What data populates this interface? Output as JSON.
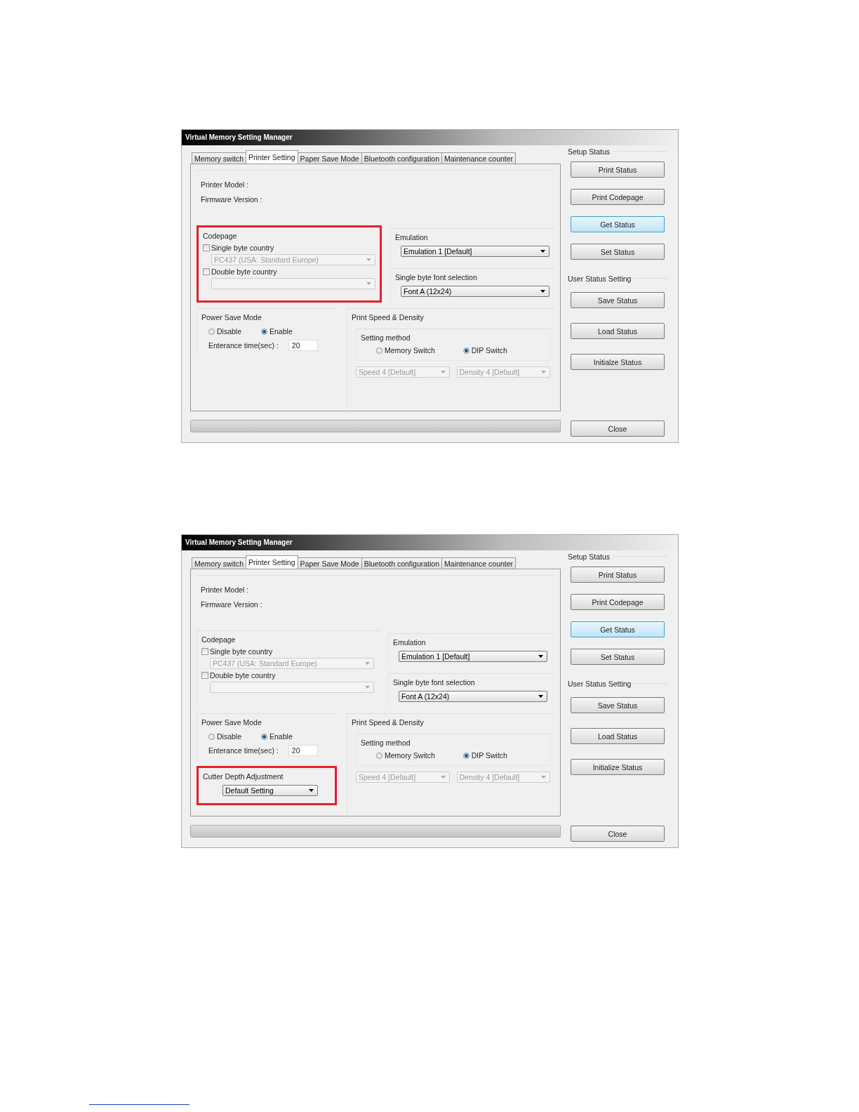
{
  "screenshots": [
    {
      "title": "Virtual Memory Setting Manager",
      "tabs": [
        {
          "label": "Memory switch",
          "selected": false
        },
        {
          "label": "Printer Setting",
          "selected": true
        },
        {
          "label": "Paper Save Mode",
          "selected": false
        },
        {
          "label": "Bluetooth configuration",
          "selected": false
        },
        {
          "label": "Maintenance counter",
          "selected": false
        }
      ],
      "info": [
        "Printer Model :",
        "Firmware Version :"
      ],
      "codepage": {
        "title": "Codepage",
        "highlighted": true,
        "options": [
          {
            "label": "Single byte country",
            "checked": false,
            "combo": {
              "value": "PC437 (USA: Standard Europe)",
              "disabled": true
            }
          },
          {
            "label": "Double byte country",
            "checked": false,
            "combo": {
              "disabled": true
            }
          }
        ]
      },
      "emulation": {
        "title": "Emulation",
        "combo": {
          "value": "Emulation 1 [Default]",
          "disabled": false
        }
      },
      "font_selection": {
        "title": "Single byte font selection",
        "combo": {
          "value": "Font A (12x24)",
          "disabled": false
        }
      },
      "power_save": {
        "title": "Power Save Mode",
        "options": [
          {
            "label": "Disable",
            "selected": false
          },
          {
            "label": "Enable",
            "selected": true
          }
        ],
        "time_label": "Enterance time(sec) :",
        "time_value": "20"
      },
      "speed_density": {
        "title": "Print Speed & Density",
        "method_title": "Setting method",
        "methods": [
          {
            "label": "Memory Switch",
            "selected": false
          },
          {
            "label": "DIP Switch",
            "selected": true
          }
        ],
        "combos": [
          {
            "value": "Speed 4 [Default]",
            "disabled": true
          },
          {
            "value": "Density 4 [Default]",
            "disabled": true
          }
        ]
      },
      "setup_status": {
        "title": "Setup Status",
        "buttons": [
          {
            "label": "Print Status",
            "focused": false
          },
          {
            "label": "Print Codepage",
            "focused": false
          },
          {
            "label": "Get Status",
            "focused": true
          },
          {
            "label": "Set Status",
            "focused": false
          }
        ]
      },
      "user_status": {
        "title": "User Status Setting",
        "buttons": [
          "Save Status",
          "Load Status",
          "Initialze Status"
        ]
      },
      "progress": {
        "level": 1
      },
      "close": "Close"
    },
    {
      "title": "Virtual Memory Setting Manager",
      "tabs": [
        {
          "label": "Memory switch",
          "selected": false
        },
        {
          "label": "Printer Setting",
          "selected": true
        },
        {
          "label": "Paper Save Mode",
          "selected": false
        },
        {
          "label": "Bluetooth configuration",
          "selected": false
        },
        {
          "label": "Maintenance counter",
          "selected": false
        }
      ],
      "info": [
        "Printer Model :",
        "Firmware Version :"
      ],
      "codepage": {
        "title": "Codepage",
        "highlighted": false,
        "options": [
          {
            "label": "Single byte country",
            "checked": false,
            "combo": {
              "value": "PC437 (USA: Standard Europe)",
              "disabled": true
            }
          },
          {
            "label": "Double byte country",
            "checked": false,
            "combo": {
              "disabled": true
            }
          }
        ]
      },
      "emulation": {
        "title": "Emulation",
        "combo": {
          "value": "Emulation 1 [Default]",
          "disabled": false
        }
      },
      "font_selection": {
        "title": "Single byte font selection",
        "combo": {
          "value": "Font A (12x24)",
          "disabled": false
        }
      },
      "power_save": {
        "title": "Power Save Mode",
        "options": [
          {
            "label": "Disable",
            "selected": false
          },
          {
            "label": "Enable",
            "selected": true
          }
        ],
        "time_label": "Enterance time(sec) :",
        "time_value": "20"
      },
      "cutter": {
        "title": "Cutter Depth Adjustment",
        "highlighted": true,
        "combo": {
          "value": "Default Setting",
          "disabled": false
        }
      },
      "speed_density": {
        "title": "Print Speed & Density",
        "method_title": "Setting method",
        "methods": [
          {
            "label": "Memory Switch",
            "selected": false
          },
          {
            "label": "DIP Switch",
            "selected": true
          }
        ],
        "combos": [
          {
            "value": "Speed 4 [Default]",
            "disabled": true
          },
          {
            "value": "Density 4 [Default]",
            "disabled": true
          }
        ]
      },
      "setup_status": {
        "title": "Setup Status",
        "buttons": [
          {
            "label": "Print Status",
            "focused": false
          },
          {
            "label": "Print Codepage",
            "focused": false
          },
          {
            "label": "Get Status",
            "focused": true
          },
          {
            "label": "Set Status",
            "focused": false
          }
        ]
      },
      "user_status": {
        "title": "User Status Setting",
        "buttons": [
          "Save Status",
          "Load Status",
          "Initialize Status"
        ]
      },
      "progress": {
        "level": 1
      },
      "close": "Close"
    }
  ]
}
